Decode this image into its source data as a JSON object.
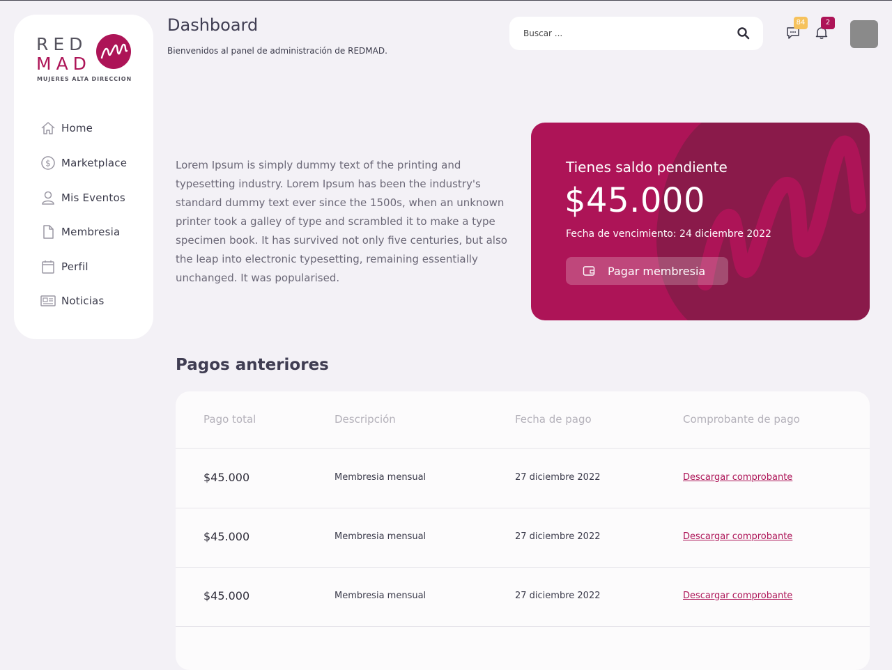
{
  "brand": {
    "logo_line1": "RED",
    "logo_line2": "MAD",
    "tagline": "MUJERES ALTA DIRECCION",
    "accent": "#ad1457"
  },
  "sidebar": {
    "items": [
      {
        "label": "Home",
        "icon": "home-icon"
      },
      {
        "label": "Marketplace",
        "icon": "dollar-circle-icon"
      },
      {
        "label": "Mis Eventos",
        "icon": "user-icon"
      },
      {
        "label": "Membresia",
        "icon": "file-icon"
      },
      {
        "label": "Perfil",
        "icon": "calendar-icon"
      },
      {
        "label": "Noticias",
        "icon": "newspaper-icon"
      }
    ]
  },
  "header": {
    "title": "Dashboard",
    "subtitle": "Bienvenidos al panel de administración de REDMAD.",
    "search_placeholder": "Buscar ...",
    "messages_count": "84",
    "notifications_count": "2"
  },
  "intro": {
    "text": "Lorem Ipsum is simply dummy text of the printing and typesetting industry. Lorem Ipsum has been the industry's standard dummy text ever since the 1500s, when an unknown printer took a galley of type and scrambled it to make a type specimen book. It has survived not only five centuries, but also the leap into electronic typesetting, remaining essentially unchanged. It was popularised."
  },
  "balance": {
    "title": "Tienes saldo pendiente",
    "amount": "$45.000",
    "due_date": "Fecha de vencimiento: 24 diciembre 2022",
    "pay_label": "Pagar membresia"
  },
  "payments": {
    "title": "Pagos anteriores",
    "columns": [
      "Pago total",
      "Descripción",
      "Fecha de pago",
      "Comprobante de pago"
    ],
    "rows": [
      {
        "amount": "$45.000",
        "description": "Membresia mensual",
        "date": "27 diciembre 2022",
        "receipt": "Descargar comprobante"
      },
      {
        "amount": "$45.000",
        "description": "Membresia mensual",
        "date": "27 diciembre 2022",
        "receipt": "Descargar comprobante"
      },
      {
        "amount": "$45.000",
        "description": "Membresia mensual",
        "date": "27 diciembre 2022",
        "receipt": "Descargar comprobante"
      }
    ]
  }
}
